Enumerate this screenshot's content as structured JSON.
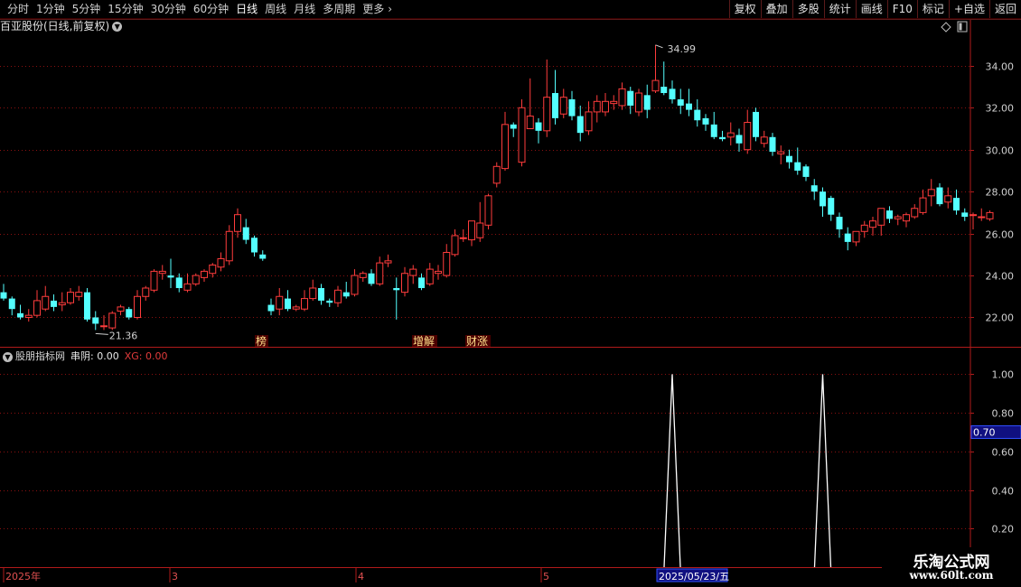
{
  "toolbar": {
    "periods": [
      "分时",
      "1分钟",
      "5分钟",
      "15分钟",
      "30分钟",
      "60分钟",
      "日线",
      "周线",
      "月线",
      "多周期",
      "更多"
    ],
    "active_period": "日线",
    "tools": [
      "复权",
      "叠加",
      "多股",
      "统计",
      "画线",
      "F10",
      "标记",
      "+自选",
      "返回"
    ]
  },
  "main_chart": {
    "title": "百亚股份(日线,前复权)",
    "high_label": "34.99",
    "low_label": "21.36",
    "event_markers": [
      "榜",
      "增解",
      "财涨"
    ]
  },
  "indicator": {
    "name": "股朋指标网",
    "chuan_label": "串阴: 0.00",
    "xg_label": "XG: 0.00",
    "cursor_value": "0.70"
  },
  "time_axis": {
    "labels": [
      "2025年",
      "3",
      "4",
      "5"
    ],
    "cursor_date": "2025/05/23/五"
  },
  "watermark": {
    "title": "乐淘公式网",
    "url": "www.60lt.com"
  },
  "colors": {
    "up": "#ff3c3c",
    "down": "#54ffff",
    "grid": "#8a1010",
    "frame": "#b01a1a"
  },
  "chart_data": [
    {
      "type": "candlestick",
      "title": "百亚股份(日线,前复权)",
      "y_ticks": [
        "22.00",
        "24.00",
        "26.00",
        "28.00",
        "30.00",
        "32.00",
        "34.00"
      ],
      "ylim": [
        20.6,
        35.5
      ],
      "candles": [
        [
          23.2,
          23.6,
          22.9,
          22.8
        ],
        [
          22.9,
          23.0,
          22.4,
          22.1
        ],
        [
          22.2,
          22.6,
          22.0,
          21.9
        ],
        [
          22.0,
          22.4,
          22.1,
          21.8
        ],
        [
          22.1,
          23.3,
          22.8,
          22.0
        ],
        [
          22.4,
          23.5,
          23.0,
          22.3
        ],
        [
          22.8,
          23.1,
          22.5,
          22.3
        ],
        [
          22.6,
          23.2,
          22.7,
          22.3
        ],
        [
          22.7,
          23.4,
          23.2,
          22.6
        ],
        [
          23.0,
          23.5,
          23.2,
          22.8
        ],
        [
          23.2,
          23.4,
          21.9,
          21.8
        ],
        [
          22.0,
          22.3,
          21.7,
          21.4
        ],
        [
          21.6,
          22.1,
          21.6,
          21.4
        ],
        [
          21.5,
          22.3,
          22.2,
          21.4
        ],
        [
          22.3,
          22.6,
          22.5,
          22.1
        ],
        [
          22.4,
          22.5,
          22.0,
          21.9
        ],
        [
          22.0,
          23.3,
          23.0,
          21.9
        ],
        [
          23.0,
          23.5,
          23.4,
          22.8
        ],
        [
          23.3,
          24.3,
          24.2,
          23.2
        ],
        [
          24.1,
          24.5,
          24.2,
          23.8
        ],
        [
          24.0,
          24.8,
          23.9,
          23.4
        ],
        [
          23.9,
          24.1,
          23.4,
          23.2
        ],
        [
          23.3,
          24.1,
          23.6,
          23.2
        ],
        [
          23.6,
          24.1,
          24.0,
          23.5
        ],
        [
          23.9,
          24.3,
          24.2,
          23.7
        ],
        [
          24.1,
          24.6,
          24.5,
          23.9
        ],
        [
          24.4,
          25.1,
          24.8,
          24.2
        ],
        [
          24.7,
          26.4,
          26.1,
          24.5
        ],
        [
          26.1,
          27.2,
          26.9,
          25.8
        ],
        [
          26.3,
          26.7,
          25.7,
          25.5
        ],
        [
          25.8,
          25.9,
          25.1,
          24.9
        ],
        [
          25.0,
          25.2,
          24.8,
          24.7
        ],
        [
          22.6,
          22.9,
          22.3,
          22.1
        ],
        [
          22.4,
          23.4,
          23.0,
          22.1
        ],
        [
          22.9,
          23.3,
          22.4,
          22.3
        ],
        [
          22.4,
          22.6,
          22.5,
          22.3
        ],
        [
          22.4,
          23.3,
          22.9,
          22.3
        ],
        [
          22.9,
          23.8,
          23.4,
          22.8
        ],
        [
          23.4,
          23.6,
          22.8,
          22.6
        ],
        [
          22.8,
          22.9,
          22.7,
          22.5
        ],
        [
          22.7,
          23.5,
          23.3,
          22.5
        ],
        [
          23.2,
          23.7,
          23.0,
          22.9
        ],
        [
          23.1,
          24.3,
          24.0,
          23.0
        ],
        [
          23.9,
          24.2,
          24.1,
          23.7
        ],
        [
          24.1,
          24.3,
          23.6,
          23.5
        ],
        [
          23.6,
          24.9,
          24.6,
          23.5
        ],
        [
          24.6,
          25.0,
          24.7,
          24.4
        ],
        [
          23.4,
          23.9,
          23.3,
          21.9
        ],
        [
          23.2,
          24.4,
          24.1,
          23.0
        ],
        [
          24.0,
          24.5,
          24.3,
          23.6
        ],
        [
          23.9,
          24.1,
          23.4,
          23.3
        ],
        [
          23.6,
          24.6,
          24.3,
          23.5
        ],
        [
          24.1,
          24.5,
          24.2,
          23.8
        ],
        [
          24.0,
          25.5,
          25.1,
          23.9
        ],
        [
          25.0,
          26.2,
          25.9,
          24.9
        ],
        [
          25.8,
          26.2,
          25.8,
          25.6
        ],
        [
          25.7,
          26.5,
          26.6,
          25.4
        ],
        [
          25.8,
          27.5,
          26.5,
          25.6
        ],
        [
          26.4,
          27.9,
          27.8,
          26.2
        ],
        [
          28.4,
          29.4,
          29.2,
          28.2
        ],
        [
          29.1,
          31.8,
          31.2,
          29.0
        ],
        [
          31.2,
          31.3,
          31.0,
          30.6
        ],
        [
          29.4,
          32.4,
          32.0,
          29.2
        ],
        [
          31.0,
          33.4,
          31.6,
          31.0
        ],
        [
          31.3,
          31.5,
          30.9,
          30.3
        ],
        [
          30.9,
          34.3,
          32.5,
          30.6
        ],
        [
          32.7,
          33.8,
          31.5,
          31.2
        ],
        [
          31.7,
          32.9,
          32.5,
          31.5
        ],
        [
          32.4,
          32.8,
          31.6,
          31.4
        ],
        [
          31.6,
          32.1,
          30.8,
          30.4
        ],
        [
          30.9,
          32.3,
          31.8,
          30.7
        ],
        [
          31.8,
          32.6,
          32.3,
          31.3
        ],
        [
          31.8,
          32.7,
          32.3,
          31.6
        ],
        [
          32.2,
          32.6,
          32.3,
          31.9
        ],
        [
          32.1,
          33.2,
          32.9,
          31.9
        ],
        [
          32.8,
          33.0,
          32.1,
          31.7
        ],
        [
          31.8,
          32.9,
          32.7,
          31.6
        ],
        [
          32.6,
          33.1,
          31.9,
          31.5
        ],
        [
          32.8,
          34.99,
          33.3,
          32.7
        ],
        [
          33.0,
          34.2,
          32.7,
          32.6
        ],
        [
          32.9,
          33.3,
          32.4,
          32.2
        ],
        [
          32.4,
          32.9,
          32.1,
          31.7
        ],
        [
          32.2,
          32.9,
          31.9,
          31.6
        ],
        [
          31.9,
          32.4,
          31.4,
          31.1
        ],
        [
          31.5,
          31.7,
          31.2,
          30.9
        ],
        [
          31.2,
          31.8,
          30.6,
          30.5
        ],
        [
          30.6,
          30.9,
          30.5,
          30.4
        ],
        [
          30.6,
          31.3,
          30.8,
          30.2
        ],
        [
          30.7,
          31.0,
          30.3,
          29.9
        ],
        [
          30.0,
          31.9,
          31.3,
          29.8
        ],
        [
          31.8,
          32.0,
          30.6,
          30.4
        ],
        [
          30.3,
          30.9,
          30.6,
          30.1
        ],
        [
          30.6,
          30.8,
          29.9,
          29.7
        ],
        [
          29.8,
          30.2,
          29.9,
          29.3
        ],
        [
          29.7,
          30.0,
          29.4,
          29.1
        ],
        [
          29.4,
          30.1,
          29.0,
          28.8
        ],
        [
          29.2,
          29.3,
          28.7,
          28.5
        ],
        [
          28.3,
          28.6,
          28.0,
          27.6
        ],
        [
          28.0,
          28.2,
          27.3,
          26.8
        ],
        [
          27.7,
          27.8,
          26.9,
          26.6
        ],
        [
          26.8,
          27.0,
          26.2,
          25.8
        ],
        [
          26.0,
          26.3,
          25.6,
          25.2
        ],
        [
          25.6,
          26.1,
          26.1,
          25.4
        ],
        [
          26.1,
          26.6,
          26.4,
          25.8
        ],
        [
          26.3,
          26.8,
          26.6,
          25.9
        ],
        [
          26.4,
          27.2,
          27.2,
          25.9
        ],
        [
          27.1,
          27.3,
          26.7,
          26.5
        ],
        [
          26.7,
          26.9,
          26.8,
          26.4
        ],
        [
          26.6,
          27.0,
          26.9,
          26.3
        ],
        [
          26.8,
          27.4,
          27.2,
          26.7
        ],
        [
          27.0,
          28.1,
          27.7,
          26.9
        ],
        [
          27.8,
          28.6,
          28.1,
          27.3
        ],
        [
          28.2,
          28.4,
          27.4,
          27.3
        ],
        [
          27.5,
          28.2,
          27.8,
          27.2
        ],
        [
          27.7,
          28.1,
          27.1,
          26.9
        ],
        [
          27.0,
          27.2,
          26.8,
          26.6
        ],
        [
          26.9,
          27.0,
          26.9,
          26.2
        ],
        [
          26.8,
          27.2,
          26.8,
          26.6
        ],
        [
          26.7,
          27.1,
          27.0,
          26.6
        ]
      ],
      "candle_format": [
        "open",
        "high",
        "close",
        "low"
      ]
    },
    {
      "type": "line",
      "title": "股朋指标网",
      "y_ticks": [
        "0.20",
        "0.40",
        "0.60",
        "0.80",
        "1.00"
      ],
      "ylim": [
        0,
        1.1
      ],
      "series": [
        {
          "name": "串阴",
          "values": [
            0,
            0,
            0,
            0,
            0,
            0,
            0,
            0,
            0,
            0,
            0,
            0,
            0,
            0,
            0,
            0,
            0,
            0,
            0,
            0,
            0,
            0,
            0,
            0,
            0,
            0,
            0,
            0,
            0,
            0,
            0,
            0,
            0,
            0,
            0,
            0,
            0,
            0,
            0,
            0,
            0,
            0,
            0,
            0,
            0,
            0,
            0,
            0,
            0,
            0,
            0,
            0,
            0,
            0,
            0,
            0,
            0,
            0,
            0,
            0,
            0,
            0,
            0,
            0,
            0,
            0,
            0,
            0,
            0,
            0,
            0,
            0,
            0,
            0,
            0,
            0,
            0,
            0,
            0,
            0,
            1,
            0,
            0,
            0,
            0,
            0,
            0,
            0,
            0,
            0,
            0,
            0,
            0,
            0,
            0,
            0,
            0,
            0,
            1,
            0,
            0,
            0,
            0,
            0,
            0,
            0,
            0,
            0,
            0,
            0,
            0,
            0,
            0,
            0,
            0,
            0,
            0,
            0,
            0
          ]
        }
      ]
    }
  ]
}
